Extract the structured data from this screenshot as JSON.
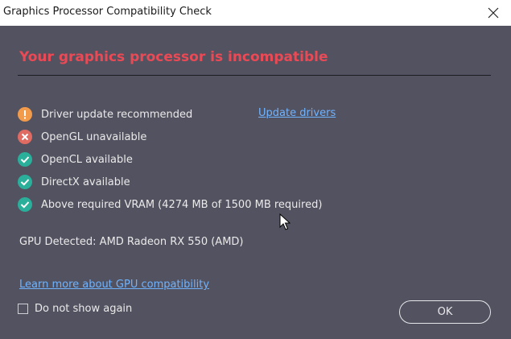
{
  "window": {
    "title": "Graphics Processor Compatibility Check",
    "close_icon": "close-icon"
  },
  "heading": "Your graphics processor is incompatible",
  "colors": {
    "warning": "#f29b4b",
    "error": "#e06b62",
    "success": "#2aaf9b",
    "heading": "#ea4a55",
    "link": "#6fb3ff"
  },
  "checks": [
    {
      "status": "warning",
      "icon": "warning-icon",
      "label": "Driver update recommended"
    },
    {
      "status": "error",
      "icon": "error-icon",
      "label": "OpenGL unavailable"
    },
    {
      "status": "ok",
      "icon": "check-icon",
      "label": "OpenCL available"
    },
    {
      "status": "ok",
      "icon": "check-icon",
      "label": "DirectX available"
    },
    {
      "status": "ok",
      "icon": "check-icon",
      "label": "Above required VRAM (4274 MB of 1500 MB required)"
    }
  ],
  "update_link": "Update drivers",
  "gpu_detected": "GPU Detected: AMD Radeon RX 550 (AMD)",
  "learn_more_link": "Learn more about GPU compatibility",
  "dont_show": {
    "label": "Do not show again",
    "checked": false
  },
  "ok_button": "OK"
}
